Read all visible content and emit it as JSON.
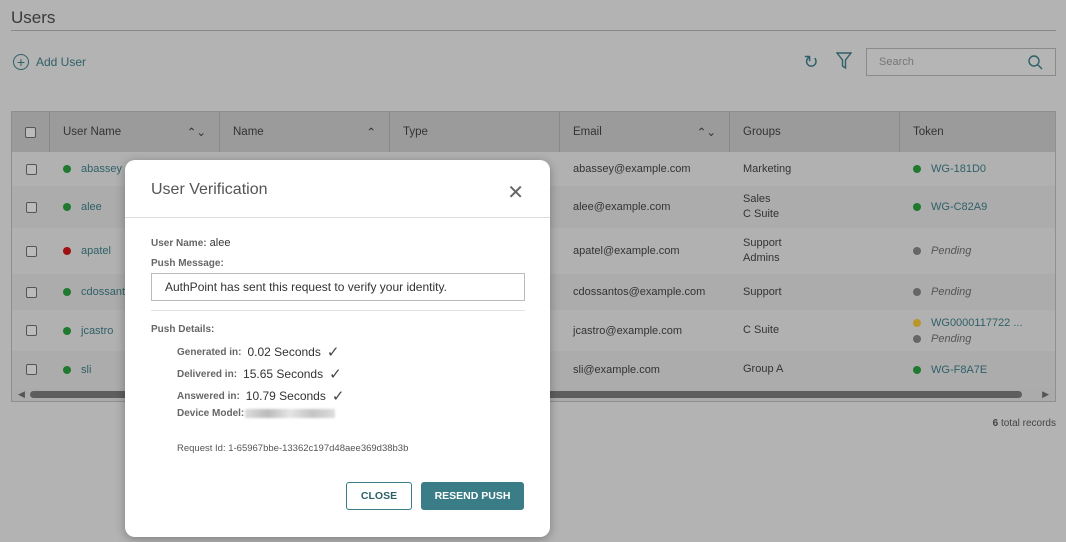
{
  "page": {
    "title": "Users",
    "add_user": "Add User",
    "search_placeholder": "Search",
    "total_count": "6",
    "total_label": "total records"
  },
  "icons": {
    "refresh": "refresh-icon",
    "filter": "filter-icon",
    "search": "search-icon"
  },
  "table": {
    "headers": [
      "User Name",
      "Name",
      "Type",
      "Email",
      "Groups",
      "Token"
    ],
    "rows": [
      {
        "user": "abassey",
        "status": "#1f7a2f",
        "email": "abassey@example.com",
        "groups": [
          "Marketing"
        ],
        "tokens": [
          {
            "color": "#1f7a2f",
            "text": "WG-181D0",
            "pending": false
          }
        ]
      },
      {
        "user": "alee",
        "status": "#1f7a2f",
        "email": "alee@example.com",
        "groups": [
          "Sales",
          "C Suite"
        ],
        "tokens": [
          {
            "color": "#1f7a2f",
            "text": "WG-C82A9",
            "pending": false
          }
        ]
      },
      {
        "user": "apatel",
        "status": "#a01010",
        "email": "apatel@example.com",
        "groups": [
          "Support",
          "Admins"
        ],
        "tokens": [
          {
            "color": "#666666",
            "text": "Pending",
            "pending": true
          }
        ]
      },
      {
        "user": "cdossantos",
        "status": "#1f7a2f",
        "email": "cdossantos@example.com",
        "groups": [
          "Support"
        ],
        "tokens": [
          {
            "color": "#666666",
            "text": "Pending",
            "pending": true
          }
        ]
      },
      {
        "user": "jcastro",
        "status": "#1f7a2f",
        "email": "jcastro@example.com",
        "groups": [
          "C Suite"
        ],
        "tokens": [
          {
            "color": "#b8962a",
            "text": "WG0000117722 ...",
            "pending": false
          },
          {
            "color": "#666666",
            "text": "Pending",
            "pending": true
          }
        ]
      },
      {
        "user": "sli",
        "status": "#1f7a2f",
        "email": "sli@example.com",
        "groups": [
          "Group A"
        ],
        "tokens": [
          {
            "color": "#1f7a2f",
            "text": "WG-F8A7E",
            "pending": false
          }
        ]
      }
    ]
  },
  "modal": {
    "title": "User Verification",
    "user_label": "User Name:",
    "user_value": "alee",
    "push_message_label": "Push Message:",
    "push_message": "AuthPoint has sent this request to verify your identity.",
    "push_details_label": "Push Details:",
    "generated_label": "Generated in:",
    "generated_value": "0.02 Seconds",
    "delivered_label": "Delivered in:",
    "delivered_value": "15.65 Seconds",
    "answered_label": "Answered in:",
    "answered_value": "10.79 Seconds",
    "device_label": "Device Model:",
    "request_id": "Request Id: 1-65967bbe-13362c197d48aee369d38b3b",
    "close": "CLOSE",
    "resend": "RESEND PUSH"
  }
}
